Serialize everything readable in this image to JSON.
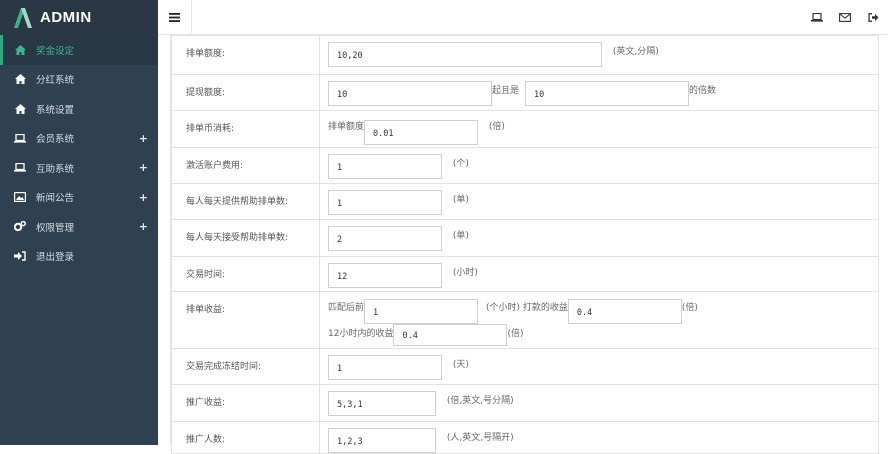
{
  "brand": {
    "name": "ADMIN"
  },
  "sidebar": {
    "items": [
      {
        "label": "奖金设定",
        "icon": "home-icon",
        "expandable": false
      },
      {
        "label": "分红系统",
        "icon": "home-icon",
        "expandable": false
      },
      {
        "label": "系统设置",
        "icon": "home-icon",
        "expandable": false
      },
      {
        "label": "会员系统",
        "icon": "laptop-icon",
        "expandable": true
      },
      {
        "label": "互助系统",
        "icon": "laptop-icon",
        "expandable": true
      },
      {
        "label": "新闻公告",
        "icon": "image-icon",
        "expandable": true
      },
      {
        "label": "权限管理",
        "icon": "cogs-icon",
        "expandable": true
      },
      {
        "label": "退出登录",
        "icon": "sign-in-icon",
        "expandable": false
      }
    ],
    "plus": "+"
  },
  "topbar": {
    "icons": [
      "laptop-icon",
      "envelope-icon",
      "sign-out-icon"
    ]
  },
  "form": {
    "row1": {
      "label": "排单额度:",
      "value": "10,20",
      "hint": "(英文,分隔)"
    },
    "row2": {
      "label": "提现额度:",
      "value": "10",
      "mid": "起且是",
      "value2": "10",
      "hint": "的倍数"
    },
    "row3": {
      "label": "排单币消耗:",
      "pre": "排单额度",
      "value": "0.01",
      "hint": "(倍)"
    },
    "row4": {
      "label": "激活账户费用:",
      "value": "1",
      "hint": "(个)"
    },
    "row5": {
      "label": "每人每天提供帮助排单数:",
      "value": "1",
      "hint": "(单)"
    },
    "row6": {
      "label": "每人每天接受帮助排单数:",
      "value": "2",
      "hint": "(单)"
    },
    "row7": {
      "label": "交易时间:",
      "value": "12",
      "hint": "(小时)"
    },
    "row8": {
      "label": "排单收益:",
      "pre": "匹配后前",
      "value": "1",
      "mid": "(个小时) 打款的收益",
      "value2": "0.4",
      "hint": "(倍)",
      "pre2": "12小时内的收益",
      "value3": "0.4",
      "hint2": "(倍)"
    },
    "row9": {
      "label": "交易完成冻结时间:",
      "value": "1",
      "hint": "(天)"
    },
    "row10": {
      "label": "推广收益:",
      "value": "5,3,1",
      "hint": "(倍,英文,号分隔)"
    },
    "row11": {
      "label": "推广人数:",
      "value": "1,2,3",
      "hint": "(人,英文,号隔开)"
    }
  }
}
